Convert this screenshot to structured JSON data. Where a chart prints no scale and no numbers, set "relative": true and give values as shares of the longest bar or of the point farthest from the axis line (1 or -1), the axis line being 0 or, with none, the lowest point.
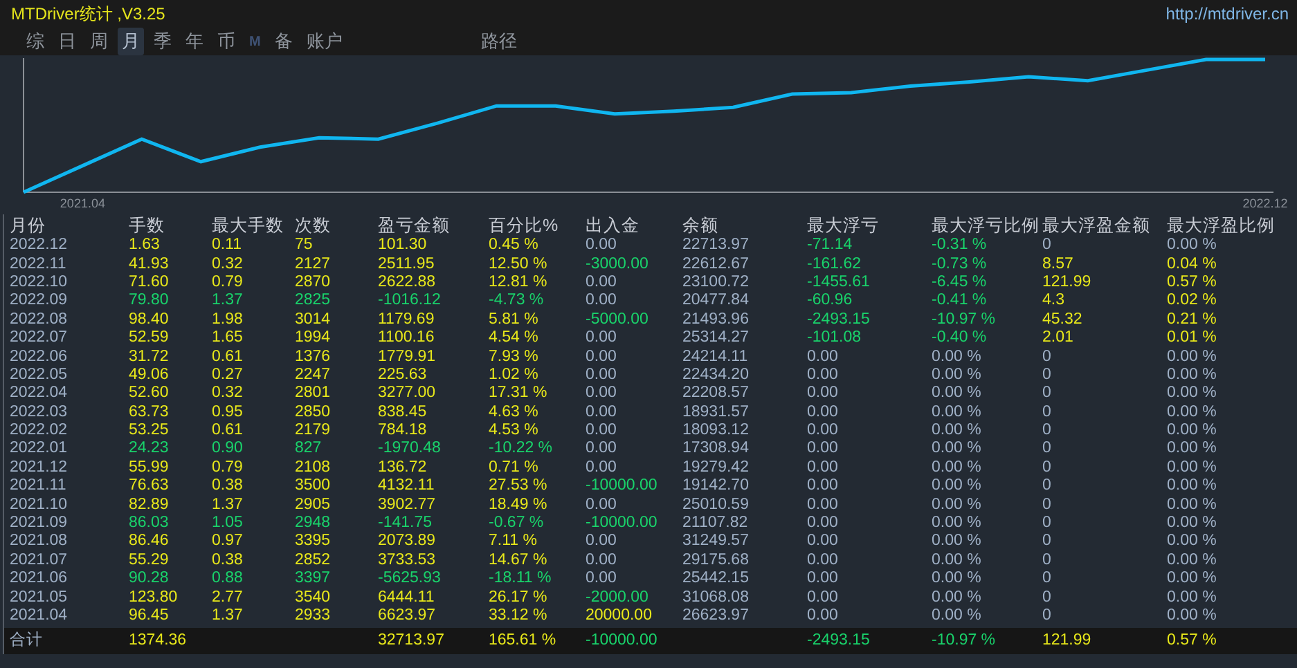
{
  "window": {
    "title": "MTDriver统计 ,V3.25",
    "link": "http://mtdriver.cn"
  },
  "tabs": [
    {
      "label": "综",
      "selected": false,
      "disabled": false
    },
    {
      "label": "日",
      "selected": false,
      "disabled": false
    },
    {
      "label": "周",
      "selected": false,
      "disabled": false
    },
    {
      "label": "月",
      "selected": true,
      "disabled": false
    },
    {
      "label": "季",
      "selected": false,
      "disabled": false
    },
    {
      "label": "年",
      "selected": false,
      "disabled": false
    },
    {
      "label": "币",
      "selected": false,
      "disabled": false
    },
    {
      "label": "M",
      "selected": false,
      "disabled": true
    },
    {
      "label": "备",
      "selected": false,
      "disabled": false
    },
    {
      "label": "账户",
      "selected": false,
      "disabled": false
    }
  ],
  "path_tab": {
    "label": "路径",
    "selected": false
  },
  "chart": {
    "chart_data": {
      "type": "line",
      "relative": true,
      "categories": [
        null,
        "2021.04",
        null,
        null,
        null,
        null,
        null,
        null,
        null,
        null,
        null,
        null,
        null,
        null,
        null,
        null,
        null,
        null,
        null,
        null,
        null,
        "2022.12"
      ],
      "series": [
        {
          "color": "#10b6f0",
          "values": [
            0,
            0.2,
            0.4,
            0.23,
            0.34,
            0.41,
            0.4,
            0.52,
            0.65,
            0.65,
            0.59,
            0.61,
            0.64,
            0.74,
            0.75,
            0.8,
            0.83,
            0.87,
            0.84,
            0.92,
            1,
            1
          ]
        }
      ]
    }
  },
  "table": {
    "columns": [
      "月份",
      "手数",
      "最大手数",
      "次数",
      "盈亏金额",
      "百分比%",
      "出入金",
      "余额",
      "最大浮亏",
      "最大浮亏比例",
      "最大浮盈金额",
      "最大浮盈比例"
    ],
    "rows": [
      {
        "cells": [
          {
            "text": "2022.12",
            "color": "#9fb0c6"
          },
          {
            "text": "1.63",
            "color": "#e8e81a"
          },
          {
            "text": "0.11",
            "color": "#e8e81a"
          },
          {
            "text": "75",
            "color": "#e8e81a"
          },
          {
            "text": "101.30",
            "color": "#e8e81a"
          },
          {
            "text": "0.45 %",
            "color": "#e8e81a"
          },
          {
            "text": "0.00",
            "color": "#9fb0c6"
          },
          {
            "text": "22713.97",
            "color": "#9fb0c6"
          },
          {
            "text": "-71.14",
            "color": "#19d36b"
          },
          {
            "text": "-0.31 %",
            "color": "#19d36b"
          },
          {
            "text": "0",
            "color": "#9fb0c6"
          },
          {
            "text": "0.00 %",
            "color": "#9fb0c6"
          }
        ]
      },
      {
        "cells": [
          {
            "text": "2022.11",
            "color": "#9fb0c6"
          },
          {
            "text": "41.93",
            "color": "#e8e81a"
          },
          {
            "text": "0.32",
            "color": "#e8e81a"
          },
          {
            "text": "2127",
            "color": "#e8e81a"
          },
          {
            "text": "2511.95",
            "color": "#e8e81a"
          },
          {
            "text": "12.50 %",
            "color": "#e8e81a"
          },
          {
            "text": "-3000.00",
            "color": "#19d36b"
          },
          {
            "text": "22612.67",
            "color": "#9fb0c6"
          },
          {
            "text": "-161.62",
            "color": "#19d36b"
          },
          {
            "text": "-0.73 %",
            "color": "#19d36b"
          },
          {
            "text": "8.57",
            "color": "#e8e81a"
          },
          {
            "text": "0.04 %",
            "color": "#e8e81a"
          }
        ]
      },
      {
        "cells": [
          {
            "text": "2022.10",
            "color": "#9fb0c6"
          },
          {
            "text": "71.60",
            "color": "#e8e81a"
          },
          {
            "text": "0.79",
            "color": "#e8e81a"
          },
          {
            "text": "2870",
            "color": "#e8e81a"
          },
          {
            "text": "2622.88",
            "color": "#e8e81a"
          },
          {
            "text": "12.81 %",
            "color": "#e8e81a"
          },
          {
            "text": "0.00",
            "color": "#9fb0c6"
          },
          {
            "text": "23100.72",
            "color": "#9fb0c6"
          },
          {
            "text": "-1455.61",
            "color": "#19d36b"
          },
          {
            "text": "-6.45 %",
            "color": "#19d36b"
          },
          {
            "text": "121.99",
            "color": "#e8e81a"
          },
          {
            "text": "0.57 %",
            "color": "#e8e81a"
          }
        ]
      },
      {
        "cells": [
          {
            "text": "2022.09",
            "color": "#9fb0c6"
          },
          {
            "text": "79.80",
            "color": "#19d36b"
          },
          {
            "text": "1.37",
            "color": "#19d36b"
          },
          {
            "text": "2825",
            "color": "#19d36b"
          },
          {
            "text": "-1016.12",
            "color": "#19d36b"
          },
          {
            "text": "-4.73 %",
            "color": "#19d36b"
          },
          {
            "text": "0.00",
            "color": "#9fb0c6"
          },
          {
            "text": "20477.84",
            "color": "#9fb0c6"
          },
          {
            "text": "-60.96",
            "color": "#19d36b"
          },
          {
            "text": "-0.41 %",
            "color": "#19d36b"
          },
          {
            "text": "4.3",
            "color": "#e8e81a"
          },
          {
            "text": "0.02 %",
            "color": "#e8e81a"
          }
        ]
      },
      {
        "cells": [
          {
            "text": "2022.08",
            "color": "#9fb0c6"
          },
          {
            "text": "98.40",
            "color": "#e8e81a"
          },
          {
            "text": "1.98",
            "color": "#e8e81a"
          },
          {
            "text": "3014",
            "color": "#e8e81a"
          },
          {
            "text": "1179.69",
            "color": "#e8e81a"
          },
          {
            "text": "5.81 %",
            "color": "#e8e81a"
          },
          {
            "text": "-5000.00",
            "color": "#19d36b"
          },
          {
            "text": "21493.96",
            "color": "#9fb0c6"
          },
          {
            "text": "-2493.15",
            "color": "#19d36b"
          },
          {
            "text": "-10.97 %",
            "color": "#19d36b"
          },
          {
            "text": "45.32",
            "color": "#e8e81a"
          },
          {
            "text": "0.21 %",
            "color": "#e8e81a"
          }
        ]
      },
      {
        "cells": [
          {
            "text": "2022.07",
            "color": "#9fb0c6"
          },
          {
            "text": "52.59",
            "color": "#e8e81a"
          },
          {
            "text": "1.65",
            "color": "#e8e81a"
          },
          {
            "text": "1994",
            "color": "#e8e81a"
          },
          {
            "text": "1100.16",
            "color": "#e8e81a"
          },
          {
            "text": "4.54 %",
            "color": "#e8e81a"
          },
          {
            "text": "0.00",
            "color": "#9fb0c6"
          },
          {
            "text": "25314.27",
            "color": "#9fb0c6"
          },
          {
            "text": "-101.08",
            "color": "#19d36b"
          },
          {
            "text": "-0.40 %",
            "color": "#19d36b"
          },
          {
            "text": "2.01",
            "color": "#e8e81a"
          },
          {
            "text": "0.01 %",
            "color": "#e8e81a"
          }
        ]
      },
      {
        "cells": [
          {
            "text": "2022.06",
            "color": "#9fb0c6"
          },
          {
            "text": "31.72",
            "color": "#e8e81a"
          },
          {
            "text": "0.61",
            "color": "#e8e81a"
          },
          {
            "text": "1376",
            "color": "#e8e81a"
          },
          {
            "text": "1779.91",
            "color": "#e8e81a"
          },
          {
            "text": "7.93 %",
            "color": "#e8e81a"
          },
          {
            "text": "0.00",
            "color": "#9fb0c6"
          },
          {
            "text": "24214.11",
            "color": "#9fb0c6"
          },
          {
            "text": "0.00",
            "color": "#9fb0c6"
          },
          {
            "text": "0.00 %",
            "color": "#9fb0c6"
          },
          {
            "text": "0",
            "color": "#9fb0c6"
          },
          {
            "text": "0.00 %",
            "color": "#9fb0c6"
          }
        ]
      },
      {
        "cells": [
          {
            "text": "2022.05",
            "color": "#9fb0c6"
          },
          {
            "text": "49.06",
            "color": "#e8e81a"
          },
          {
            "text": "0.27",
            "color": "#e8e81a"
          },
          {
            "text": "2247",
            "color": "#e8e81a"
          },
          {
            "text": "225.63",
            "color": "#e8e81a"
          },
          {
            "text": "1.02 %",
            "color": "#e8e81a"
          },
          {
            "text": "0.00",
            "color": "#9fb0c6"
          },
          {
            "text": "22434.20",
            "color": "#9fb0c6"
          },
          {
            "text": "0.00",
            "color": "#9fb0c6"
          },
          {
            "text": "0.00 %",
            "color": "#9fb0c6"
          },
          {
            "text": "0",
            "color": "#9fb0c6"
          },
          {
            "text": "0.00 %",
            "color": "#9fb0c6"
          }
        ]
      },
      {
        "cells": [
          {
            "text": "2022.04",
            "color": "#9fb0c6"
          },
          {
            "text": "52.60",
            "color": "#e8e81a"
          },
          {
            "text": "0.32",
            "color": "#e8e81a"
          },
          {
            "text": "2801",
            "color": "#e8e81a"
          },
          {
            "text": "3277.00",
            "color": "#e8e81a"
          },
          {
            "text": "17.31 %",
            "color": "#e8e81a"
          },
          {
            "text": "0.00",
            "color": "#9fb0c6"
          },
          {
            "text": "22208.57",
            "color": "#9fb0c6"
          },
          {
            "text": "0.00",
            "color": "#9fb0c6"
          },
          {
            "text": "0.00 %",
            "color": "#9fb0c6"
          },
          {
            "text": "0",
            "color": "#9fb0c6"
          },
          {
            "text": "0.00 %",
            "color": "#9fb0c6"
          }
        ]
      },
      {
        "cells": [
          {
            "text": "2022.03",
            "color": "#9fb0c6"
          },
          {
            "text": "63.73",
            "color": "#e8e81a"
          },
          {
            "text": "0.95",
            "color": "#e8e81a"
          },
          {
            "text": "2850",
            "color": "#e8e81a"
          },
          {
            "text": "838.45",
            "color": "#e8e81a"
          },
          {
            "text": "4.63 %",
            "color": "#e8e81a"
          },
          {
            "text": "0.00",
            "color": "#9fb0c6"
          },
          {
            "text": "18931.57",
            "color": "#9fb0c6"
          },
          {
            "text": "0.00",
            "color": "#9fb0c6"
          },
          {
            "text": "0.00 %",
            "color": "#9fb0c6"
          },
          {
            "text": "0",
            "color": "#9fb0c6"
          },
          {
            "text": "0.00 %",
            "color": "#9fb0c6"
          }
        ]
      },
      {
        "cells": [
          {
            "text": "2022.02",
            "color": "#9fb0c6"
          },
          {
            "text": "53.25",
            "color": "#e8e81a"
          },
          {
            "text": "0.61",
            "color": "#e8e81a"
          },
          {
            "text": "2179",
            "color": "#e8e81a"
          },
          {
            "text": "784.18",
            "color": "#e8e81a"
          },
          {
            "text": "4.53 %",
            "color": "#e8e81a"
          },
          {
            "text": "0.00",
            "color": "#9fb0c6"
          },
          {
            "text": "18093.12",
            "color": "#9fb0c6"
          },
          {
            "text": "0.00",
            "color": "#9fb0c6"
          },
          {
            "text": "0.00 %",
            "color": "#9fb0c6"
          },
          {
            "text": "0",
            "color": "#9fb0c6"
          },
          {
            "text": "0.00 %",
            "color": "#9fb0c6"
          }
        ]
      },
      {
        "cells": [
          {
            "text": "2022.01",
            "color": "#9fb0c6"
          },
          {
            "text": "24.23",
            "color": "#19d36b"
          },
          {
            "text": "0.90",
            "color": "#19d36b"
          },
          {
            "text": "827",
            "color": "#19d36b"
          },
          {
            "text": "-1970.48",
            "color": "#19d36b"
          },
          {
            "text": "-10.22 %",
            "color": "#19d36b"
          },
          {
            "text": "0.00",
            "color": "#9fb0c6"
          },
          {
            "text": "17308.94",
            "color": "#9fb0c6"
          },
          {
            "text": "0.00",
            "color": "#9fb0c6"
          },
          {
            "text": "0.00 %",
            "color": "#9fb0c6"
          },
          {
            "text": "0",
            "color": "#9fb0c6"
          },
          {
            "text": "0.00 %",
            "color": "#9fb0c6"
          }
        ]
      },
      {
        "cells": [
          {
            "text": "2021.12",
            "color": "#9fb0c6"
          },
          {
            "text": "55.99",
            "color": "#e8e81a"
          },
          {
            "text": "0.79",
            "color": "#e8e81a"
          },
          {
            "text": "2108",
            "color": "#e8e81a"
          },
          {
            "text": "136.72",
            "color": "#e8e81a"
          },
          {
            "text": "0.71 %",
            "color": "#e8e81a"
          },
          {
            "text": "0.00",
            "color": "#9fb0c6"
          },
          {
            "text": "19279.42",
            "color": "#9fb0c6"
          },
          {
            "text": "0.00",
            "color": "#9fb0c6"
          },
          {
            "text": "0.00 %",
            "color": "#9fb0c6"
          },
          {
            "text": "0",
            "color": "#9fb0c6"
          },
          {
            "text": "0.00 %",
            "color": "#9fb0c6"
          }
        ]
      },
      {
        "cells": [
          {
            "text": "2021.11",
            "color": "#9fb0c6"
          },
          {
            "text": "76.63",
            "color": "#e8e81a"
          },
          {
            "text": "0.38",
            "color": "#e8e81a"
          },
          {
            "text": "3500",
            "color": "#e8e81a"
          },
          {
            "text": "4132.11",
            "color": "#e8e81a"
          },
          {
            "text": "27.53 %",
            "color": "#e8e81a"
          },
          {
            "text": "-10000.00",
            "color": "#19d36b"
          },
          {
            "text": "19142.70",
            "color": "#9fb0c6"
          },
          {
            "text": "0.00",
            "color": "#9fb0c6"
          },
          {
            "text": "0.00 %",
            "color": "#9fb0c6"
          },
          {
            "text": "0",
            "color": "#9fb0c6"
          },
          {
            "text": "0.00 %",
            "color": "#9fb0c6"
          }
        ]
      },
      {
        "cells": [
          {
            "text": "2021.10",
            "color": "#9fb0c6"
          },
          {
            "text": "82.89",
            "color": "#e8e81a"
          },
          {
            "text": "1.37",
            "color": "#e8e81a"
          },
          {
            "text": "2905",
            "color": "#e8e81a"
          },
          {
            "text": "3902.77",
            "color": "#e8e81a"
          },
          {
            "text": "18.49 %",
            "color": "#e8e81a"
          },
          {
            "text": "0.00",
            "color": "#9fb0c6"
          },
          {
            "text": "25010.59",
            "color": "#9fb0c6"
          },
          {
            "text": "0.00",
            "color": "#9fb0c6"
          },
          {
            "text": "0.00 %",
            "color": "#9fb0c6"
          },
          {
            "text": "0",
            "color": "#9fb0c6"
          },
          {
            "text": "0.00 %",
            "color": "#9fb0c6"
          }
        ]
      },
      {
        "cells": [
          {
            "text": "2021.09",
            "color": "#9fb0c6"
          },
          {
            "text": "86.03",
            "color": "#19d36b"
          },
          {
            "text": "1.05",
            "color": "#19d36b"
          },
          {
            "text": "2948",
            "color": "#19d36b"
          },
          {
            "text": "-141.75",
            "color": "#19d36b"
          },
          {
            "text": "-0.67 %",
            "color": "#19d36b"
          },
          {
            "text": "-10000.00",
            "color": "#19d36b"
          },
          {
            "text": "21107.82",
            "color": "#9fb0c6"
          },
          {
            "text": "0.00",
            "color": "#9fb0c6"
          },
          {
            "text": "0.00 %",
            "color": "#9fb0c6"
          },
          {
            "text": "0",
            "color": "#9fb0c6"
          },
          {
            "text": "0.00 %",
            "color": "#9fb0c6"
          }
        ]
      },
      {
        "cells": [
          {
            "text": "2021.08",
            "color": "#9fb0c6"
          },
          {
            "text": "86.46",
            "color": "#e8e81a"
          },
          {
            "text": "0.97",
            "color": "#e8e81a"
          },
          {
            "text": "3395",
            "color": "#e8e81a"
          },
          {
            "text": "2073.89",
            "color": "#e8e81a"
          },
          {
            "text": "7.11 %",
            "color": "#e8e81a"
          },
          {
            "text": "0.00",
            "color": "#9fb0c6"
          },
          {
            "text": "31249.57",
            "color": "#9fb0c6"
          },
          {
            "text": "0.00",
            "color": "#9fb0c6"
          },
          {
            "text": "0.00 %",
            "color": "#9fb0c6"
          },
          {
            "text": "0",
            "color": "#9fb0c6"
          },
          {
            "text": "0.00 %",
            "color": "#9fb0c6"
          }
        ]
      },
      {
        "cells": [
          {
            "text": "2021.07",
            "color": "#9fb0c6"
          },
          {
            "text": "55.29",
            "color": "#e8e81a"
          },
          {
            "text": "0.38",
            "color": "#e8e81a"
          },
          {
            "text": "2852",
            "color": "#e8e81a"
          },
          {
            "text": "3733.53",
            "color": "#e8e81a"
          },
          {
            "text": "14.67 %",
            "color": "#e8e81a"
          },
          {
            "text": "0.00",
            "color": "#9fb0c6"
          },
          {
            "text": "29175.68",
            "color": "#9fb0c6"
          },
          {
            "text": "0.00",
            "color": "#9fb0c6"
          },
          {
            "text": "0.00 %",
            "color": "#9fb0c6"
          },
          {
            "text": "0",
            "color": "#9fb0c6"
          },
          {
            "text": "0.00 %",
            "color": "#9fb0c6"
          }
        ]
      },
      {
        "cells": [
          {
            "text": "2021.06",
            "color": "#9fb0c6"
          },
          {
            "text": "90.28",
            "color": "#19d36b"
          },
          {
            "text": "0.88",
            "color": "#19d36b"
          },
          {
            "text": "3397",
            "color": "#19d36b"
          },
          {
            "text": "-5625.93",
            "color": "#19d36b"
          },
          {
            "text": "-18.11 %",
            "color": "#19d36b"
          },
          {
            "text": "0.00",
            "color": "#9fb0c6"
          },
          {
            "text": "25442.15",
            "color": "#9fb0c6"
          },
          {
            "text": "0.00",
            "color": "#9fb0c6"
          },
          {
            "text": "0.00 %",
            "color": "#9fb0c6"
          },
          {
            "text": "0",
            "color": "#9fb0c6"
          },
          {
            "text": "0.00 %",
            "color": "#9fb0c6"
          }
        ]
      },
      {
        "cells": [
          {
            "text": "2021.05",
            "color": "#9fb0c6"
          },
          {
            "text": "123.80",
            "color": "#e8e81a"
          },
          {
            "text": "2.77",
            "color": "#e8e81a"
          },
          {
            "text": "3540",
            "color": "#e8e81a"
          },
          {
            "text": "6444.11",
            "color": "#e8e81a"
          },
          {
            "text": "26.17 %",
            "color": "#e8e81a"
          },
          {
            "text": "-2000.00",
            "color": "#19d36b"
          },
          {
            "text": "31068.08",
            "color": "#9fb0c6"
          },
          {
            "text": "0.00",
            "color": "#9fb0c6"
          },
          {
            "text": "0.00 %",
            "color": "#9fb0c6"
          },
          {
            "text": "0",
            "color": "#9fb0c6"
          },
          {
            "text": "0.00 %",
            "color": "#9fb0c6"
          }
        ]
      },
      {
        "cells": [
          {
            "text": "2021.04",
            "color": "#9fb0c6"
          },
          {
            "text": "96.45",
            "color": "#e8e81a"
          },
          {
            "text": "1.37",
            "color": "#e8e81a"
          },
          {
            "text": "2933",
            "color": "#e8e81a"
          },
          {
            "text": "6623.97",
            "color": "#e8e81a"
          },
          {
            "text": "33.12 %",
            "color": "#e8e81a"
          },
          {
            "text": "20000.00",
            "color": "#e8e81a"
          },
          {
            "text": "26623.97",
            "color": "#9fb0c6"
          },
          {
            "text": "0.00",
            "color": "#9fb0c6"
          },
          {
            "text": "0.00 %",
            "color": "#9fb0c6"
          },
          {
            "text": "0",
            "color": "#9fb0c6"
          },
          {
            "text": "0.00 %",
            "color": "#9fb0c6"
          }
        ]
      }
    ],
    "total": {
      "cells": [
        {
          "text": "合计",
          "color": "#9fb0c6"
        },
        {
          "text": "1374.36",
          "color": "#e8e81a"
        },
        null,
        null,
        {
          "text": "32713.97",
          "color": "#e8e81a"
        },
        {
          "text": "165.61 %",
          "color": "#e8e81a"
        },
        {
          "text": "-10000.00",
          "color": "#19d36b"
        },
        null,
        {
          "text": "-2493.15",
          "color": "#19d36b"
        },
        {
          "text": "-10.97 %",
          "color": "#19d36b"
        },
        {
          "text": "121.99",
          "color": "#e8e81a"
        },
        {
          "text": "0.57 %",
          "color": "#e8e81a"
        }
      ]
    }
  }
}
